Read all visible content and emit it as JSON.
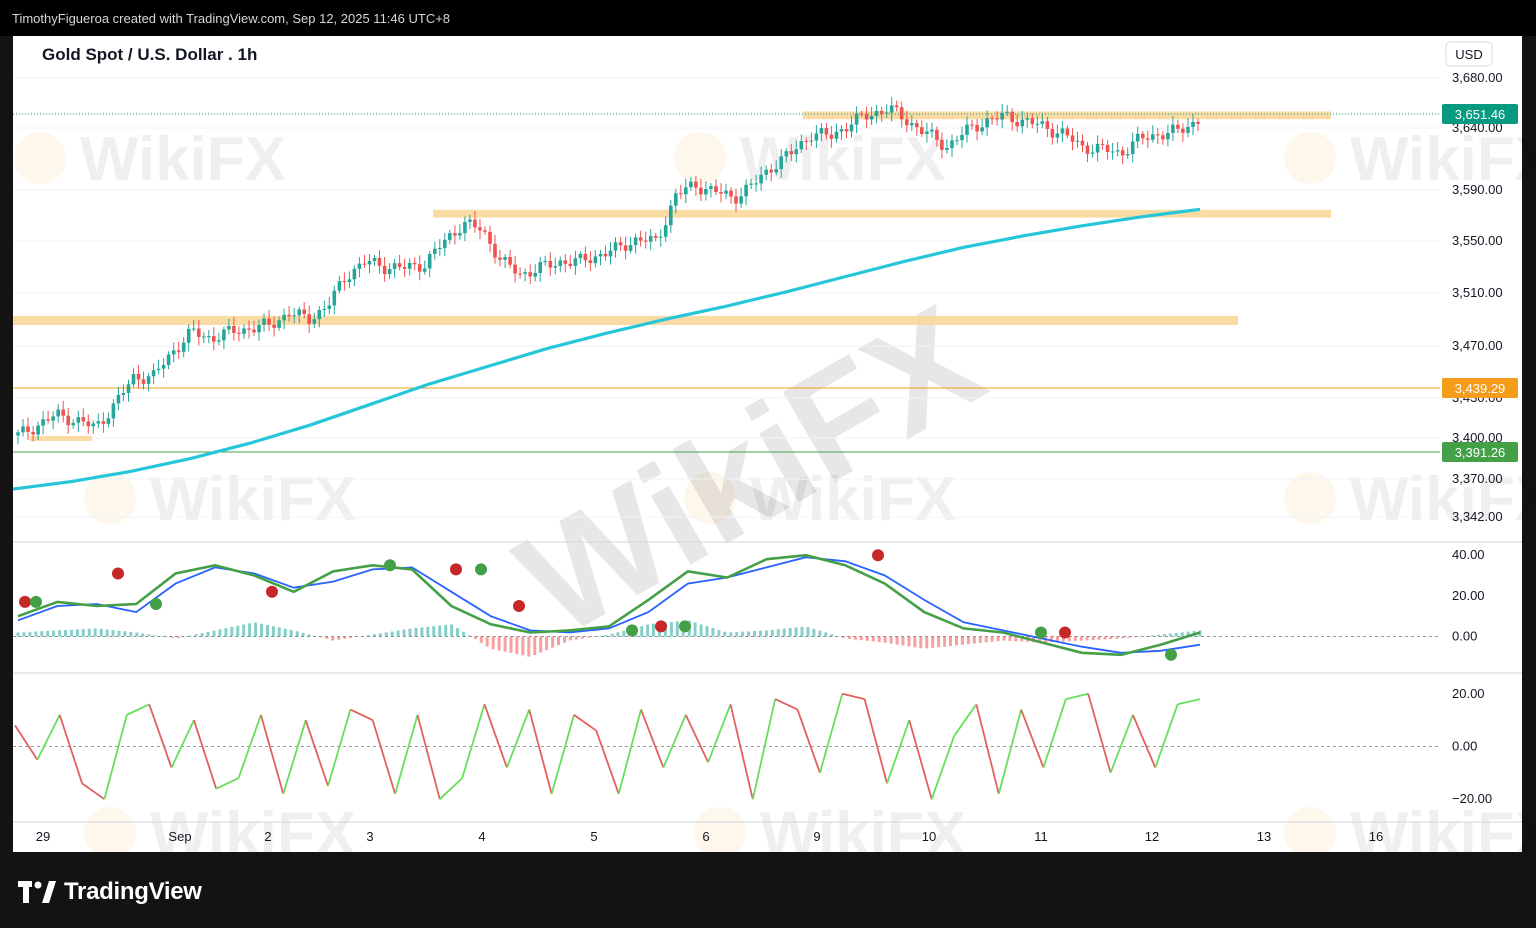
{
  "header": {
    "credit": "TimothyFigueroa created with TradingView.com, Sep 12, 2025 11:46 UTC+8"
  },
  "brand": {
    "name": "TradingView"
  },
  "watermark": {
    "text": "WikiFX"
  },
  "colors": {
    "up": "#26a69a",
    "down": "#ef5350",
    "ma": "#26c6da",
    "zone": "#fbd79a",
    "macd_fast": "#43a047",
    "macd_slow": "#2962ff",
    "macd_line": "#b71c1c",
    "osc_up": "#66e05a",
    "osc_down": "#e26060",
    "level_orange": "#f59c1a",
    "level_green": "#43a047",
    "last_price": "#089981"
  },
  "chart_data": {
    "type": "line",
    "title": "Gold Spot / U.S. Dollar . 1h",
    "currency": "USD",
    "x_labels": [
      "29",
      "Sep",
      "2",
      "3",
      "4",
      "5",
      "6",
      "9",
      "10",
      "11",
      "12",
      "13",
      "16"
    ],
    "price_axis": {
      "ticks": [
        "3,680.00",
        "3,640.00",
        "3,590.00",
        "3,550.00",
        "3,510.00",
        "3,470.00",
        "3,430.00",
        "3,400.00",
        "3,370.00",
        "3,342.00"
      ],
      "range": [
        3330,
        3690
      ]
    },
    "price_labels": {
      "last": "3,651.46",
      "level_1": "3,439.29",
      "level_2": "3,391.26"
    },
    "series": [
      {
        "name": "Price",
        "values": [
          3404,
          3412,
          3420,
          3416,
          3410,
          3428,
          3450,
          3450,
          3470,
          3485,
          3480,
          3485,
          3488,
          3490,
          3500,
          3495,
          3505,
          3530,
          3540,
          3536,
          3535,
          3538,
          3555,
          3570,
          3565,
          3540,
          3530,
          3535,
          3540,
          3540,
          3545,
          3550,
          3558,
          3555,
          3592,
          3600,
          3595,
          3590,
          3600,
          3615,
          3625,
          3640,
          3638,
          3648,
          3655,
          3660,
          3650,
          3640,
          3630,
          3642,
          3650,
          3654,
          3650,
          3646,
          3640,
          3630,
          3628,
          3625,
          3636,
          3640,
          3642,
          3651
        ]
      },
      {
        "name": "MA",
        "values": [
          3362,
          3368,
          3376,
          3386,
          3398,
          3412,
          3428,
          3444,
          3458,
          3472,
          3484,
          3495,
          3505,
          3516,
          3528,
          3540,
          3551,
          3560,
          3568,
          3575,
          3581
        ]
      }
    ],
    "support_zones": [
      {
        "from": 3653,
        "to": 3656
      },
      {
        "from": 3576,
        "to": 3579
      },
      {
        "from": 3492,
        "to": 3496
      }
    ],
    "macd": {
      "axis_ticks": [
        "40.00",
        "20.00",
        "0.00"
      ],
      "range": [
        -14,
        45
      ],
      "fast": [
        10,
        17,
        15,
        16,
        31,
        35,
        30,
        22,
        32,
        35,
        33,
        15,
        6,
        2,
        3,
        5,
        18,
        32,
        29,
        38,
        40,
        35,
        26,
        12,
        4,
        2,
        -3,
        -8,
        -9,
        -4,
        2
      ],
      "slow": [
        8,
        15,
        16,
        12,
        26,
        34,
        31,
        24,
        27,
        33,
        34,
        22,
        10,
        3,
        2,
        4,
        12,
        26,
        29,
        34,
        39,
        37,
        30,
        18,
        7,
        3,
        -1,
        -5,
        -8,
        -7,
        -4
      ],
      "histogram": [
        2,
        3,
        4,
        2,
        -1,
        3,
        7,
        3,
        -2,
        1,
        4,
        6,
        -6,
        -10,
        -2,
        1,
        6,
        8,
        2,
        3,
        5,
        -1,
        -3,
        -6,
        -4,
        -2,
        -3,
        -2,
        -1,
        1,
        3
      ]
    },
    "oscillator": {
      "axis_ticks": [
        "20.00",
        "0.00",
        "−20.00"
      ],
      "range": [
        -26,
        26
      ],
      "values": [
        8,
        -5,
        12,
        -14,
        -20,
        12,
        16,
        -8,
        10,
        -16,
        -12,
        12,
        -18,
        10,
        -15,
        14,
        10,
        -18,
        12,
        -20,
        -12,
        16,
        -8,
        14,
        -18,
        12,
        6,
        -18,
        14,
        -8,
        12,
        -6,
        16,
        -20,
        18,
        14,
        -10,
        20,
        18,
        -14,
        10,
        -20,
        4,
        16,
        -18,
        14,
        -8,
        18,
        20,
        -10,
        12,
        -8,
        16,
        18
      ]
    }
  }
}
